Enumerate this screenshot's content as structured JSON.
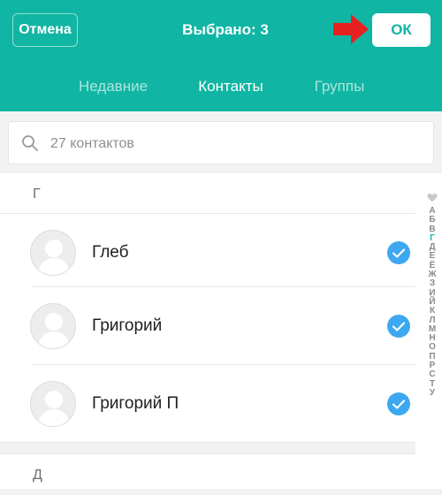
{
  "header": {
    "cancel_label": "Отмена",
    "title": "Выбрано: 3",
    "ok_label": "ОК",
    "accent_color": "#11b5a3",
    "arrow_color": "#e8201f",
    "tabs": [
      {
        "label": "Недавние",
        "active": false
      },
      {
        "label": "Контакты",
        "active": true
      },
      {
        "label": "Группы",
        "active": false
      }
    ]
  },
  "search": {
    "placeholder": "27 контактов",
    "icon": "search-icon"
  },
  "sections": [
    {
      "letter": "Г",
      "contacts": [
        {
          "name": "Глеб",
          "selected": true
        },
        {
          "name": "Григорий",
          "selected": true
        },
        {
          "name": "Григорий П",
          "selected": true
        }
      ]
    },
    {
      "letter": "Д",
      "contacts": []
    }
  ],
  "alphabet_index": {
    "favorites_icon": "heart-icon",
    "letters": [
      "А",
      "Б",
      "В",
      "Г",
      "Д",
      "Е",
      "Ё",
      "Ж",
      "З",
      "И",
      "Й",
      "К",
      "Л",
      "М",
      "Н",
      "О",
      "П",
      "Р",
      "С",
      "Т",
      "У"
    ],
    "active": "Г"
  },
  "check_color": "#3da8f0"
}
